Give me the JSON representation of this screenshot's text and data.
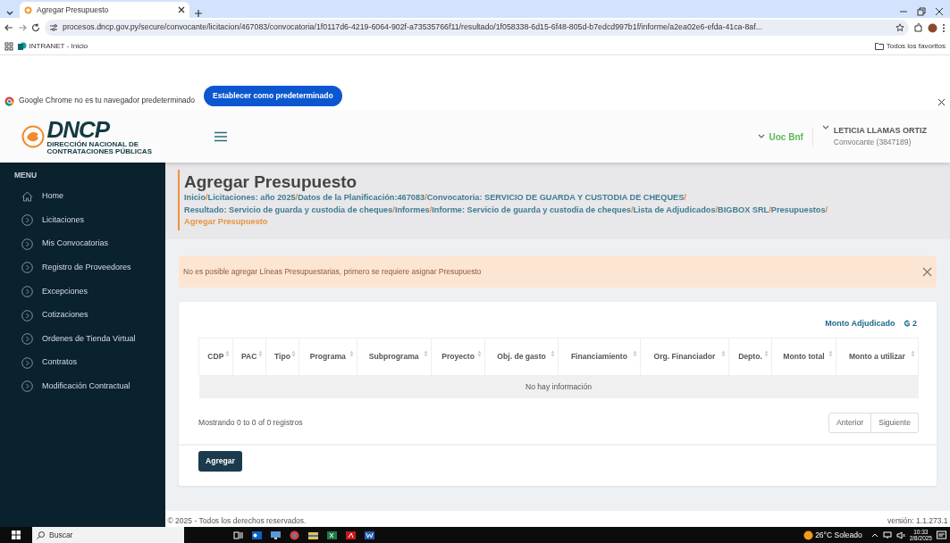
{
  "browser": {
    "tab_title": "Agregar Presupuesto",
    "url": "procesos.dncp.gov.py/secure/convocante/licitacion/467083/convocatoria/1f0117d6-4219-6064-902f-a73535766f11/resultado/1f058338-6d15-6f48-805d-b7edcd997b1f/informe/a2ea02e6-efda-41ca-8af...",
    "bookmarks": [
      {
        "label": "INTRANET - Inicio"
      }
    ],
    "favorites_label": "Todos los favoritos",
    "infobar": {
      "message": "Google Chrome no es tu navegador predeterminado",
      "button": "Establecer como predeterminado"
    }
  },
  "header": {
    "logo_name": "DNCP",
    "logo_subtitle": "DIRECCIÓN NACIONAL DE CONTRATACIONES PÚBLICAS",
    "unit": "Uoc Bnf",
    "user_name": "LETICIA LLAMAS ORTIZ",
    "user_role": "Convocante (3847189)"
  },
  "sidebar": {
    "heading": "MENU",
    "items": [
      {
        "label": "Home",
        "kind": "home"
      },
      {
        "label": "Licitaciones",
        "kind": "item"
      },
      {
        "label": "Mis Convocatorias",
        "kind": "item"
      },
      {
        "label": "Registro de Proveedores",
        "kind": "item"
      },
      {
        "label": "Excepciones",
        "kind": "item"
      },
      {
        "label": "Cotizaciones",
        "kind": "item"
      },
      {
        "label": "Ordenes de Tienda Virtual",
        "kind": "item"
      },
      {
        "label": "Contratos",
        "kind": "item"
      },
      {
        "label": "Modificación Contractual",
        "kind": "item"
      }
    ]
  },
  "page": {
    "title": "Agregar Presupuesto",
    "separator": "/",
    "breadcrumb_lines": [
      [
        {
          "label": "Inicio",
          "current": false
        },
        {
          "label": "Licitaciones: año 2025",
          "current": false
        },
        {
          "label": "Datos de la Planificación:467083",
          "current": false
        },
        {
          "label": "Convocatoria: SERVICIO DE GUARDA Y CUSTODIA DE CHEQUES",
          "current": false
        }
      ],
      [
        {
          "label": "Resultado: Servicio de guarda y custodia de cheques",
          "current": false
        },
        {
          "label": "Informes",
          "current": false
        },
        {
          "label": "Informe: Servicio de guarda y custodia de cheques",
          "current": false
        },
        {
          "label": "Lista de Adjudicados",
          "current": false
        },
        {
          "label": "BIGBOX SRL",
          "current": false
        },
        {
          "label": "Presupuestos",
          "current": false
        }
      ],
      [
        {
          "label": "Agregar Presupuesto",
          "current": true
        }
      ]
    ],
    "alert": "No es posible agregar Líneas Presupuestarias, primero se requiere asignar Presupuesto",
    "monto_label": "Monto Adjudicado",
    "monto_value": "₲ 2",
    "table": {
      "columns": [
        "CDP",
        "PAC",
        "Tipo",
        "Programa",
        "Subprograma",
        "Proyecto",
        "Obj. de gasto",
        "Financiamiento",
        "Org. Financiador",
        "Depto.",
        "Monto total",
        "Monto a utilizar"
      ],
      "empty_message": "No hay información"
    },
    "info": "Mostrando 0 to 0 of 0 registros",
    "pagination": [
      "Anterior",
      "Siguiente"
    ],
    "add_button": "Agregar"
  },
  "footer": {
    "copyright": "© 2025 - Todos los derechos reservados.",
    "version": "versión: 1.1.273.1"
  },
  "taskbar": {
    "search": "Buscar",
    "weather": "26°C  Soleado",
    "time": "10:33",
    "date": "2/8/2025"
  }
}
